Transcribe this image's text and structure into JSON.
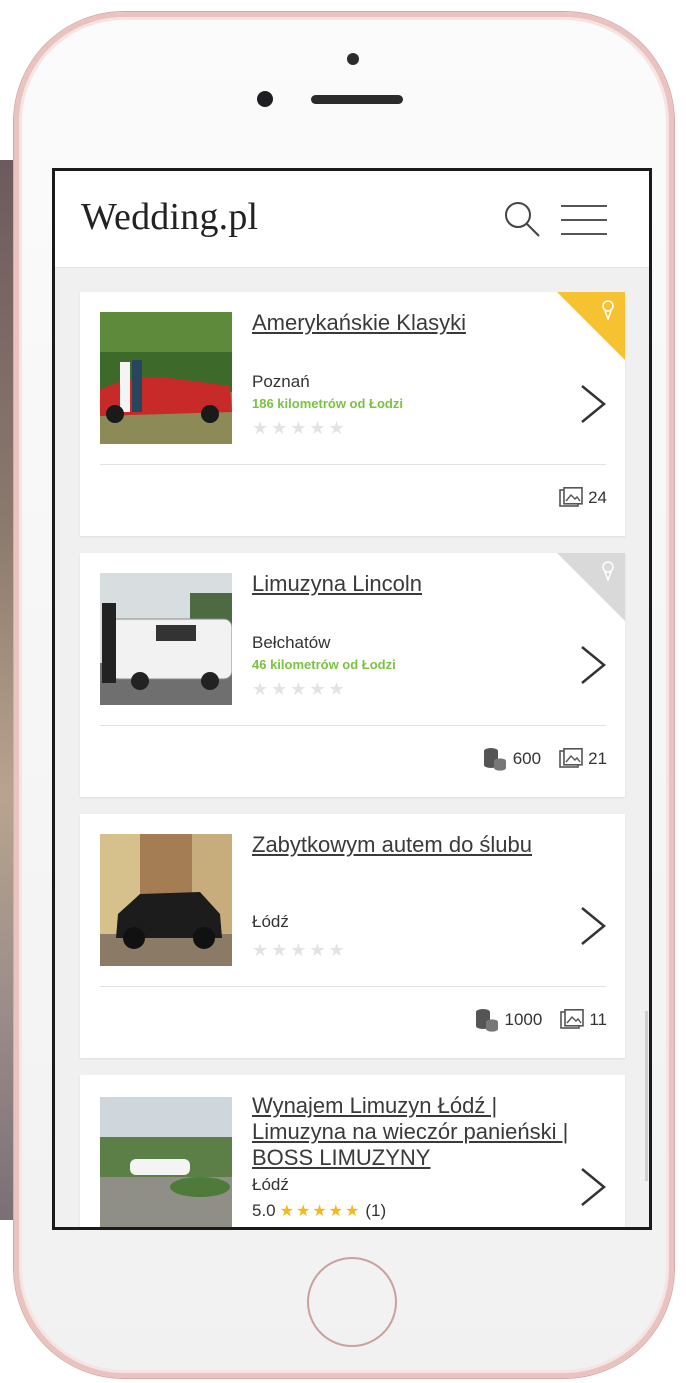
{
  "app": {
    "logo": "Wedding.pl"
  },
  "listings": [
    {
      "title": "Amerykańskie Klasyki",
      "city": "Poznań",
      "distance": "186 kilometrów od Łodzi",
      "stars": "★★★★★",
      "featured": "gold",
      "stats": {
        "photos": "24"
      }
    },
    {
      "title": "Limuzyna Lincoln",
      "city": "Bełchatów",
      "distance": "46 kilometrów od Łodzi",
      "stars": "★★★★★",
      "featured": "grey",
      "stats": {
        "guests": "600",
        "photos": "21"
      }
    },
    {
      "title": "Zabytkowym autem do ślubu",
      "city": "Łódź",
      "stars": "★★★★★",
      "stats": {
        "guests": "1000",
        "photos": "11"
      }
    },
    {
      "title": "Wynajem Limuzyn Łódź | Limuzyna na wieczór panieński | BOSS LIMUZYNY",
      "city": "Łódź",
      "rating_value": "5.0",
      "rating_stars": "★★★★★",
      "rating_count": "(1)"
    }
  ],
  "colors": {
    "accent_green": "#7cc242",
    "badge_gold": "#f6c232",
    "badge_grey": "#d9d9d9",
    "star_gold": "#f2b91f"
  },
  "icons": [
    "search-icon",
    "hamburger-menu-icon",
    "chevron-right-icon",
    "photo-gallery-icon",
    "coins-icon",
    "bouquet-icon"
  ]
}
